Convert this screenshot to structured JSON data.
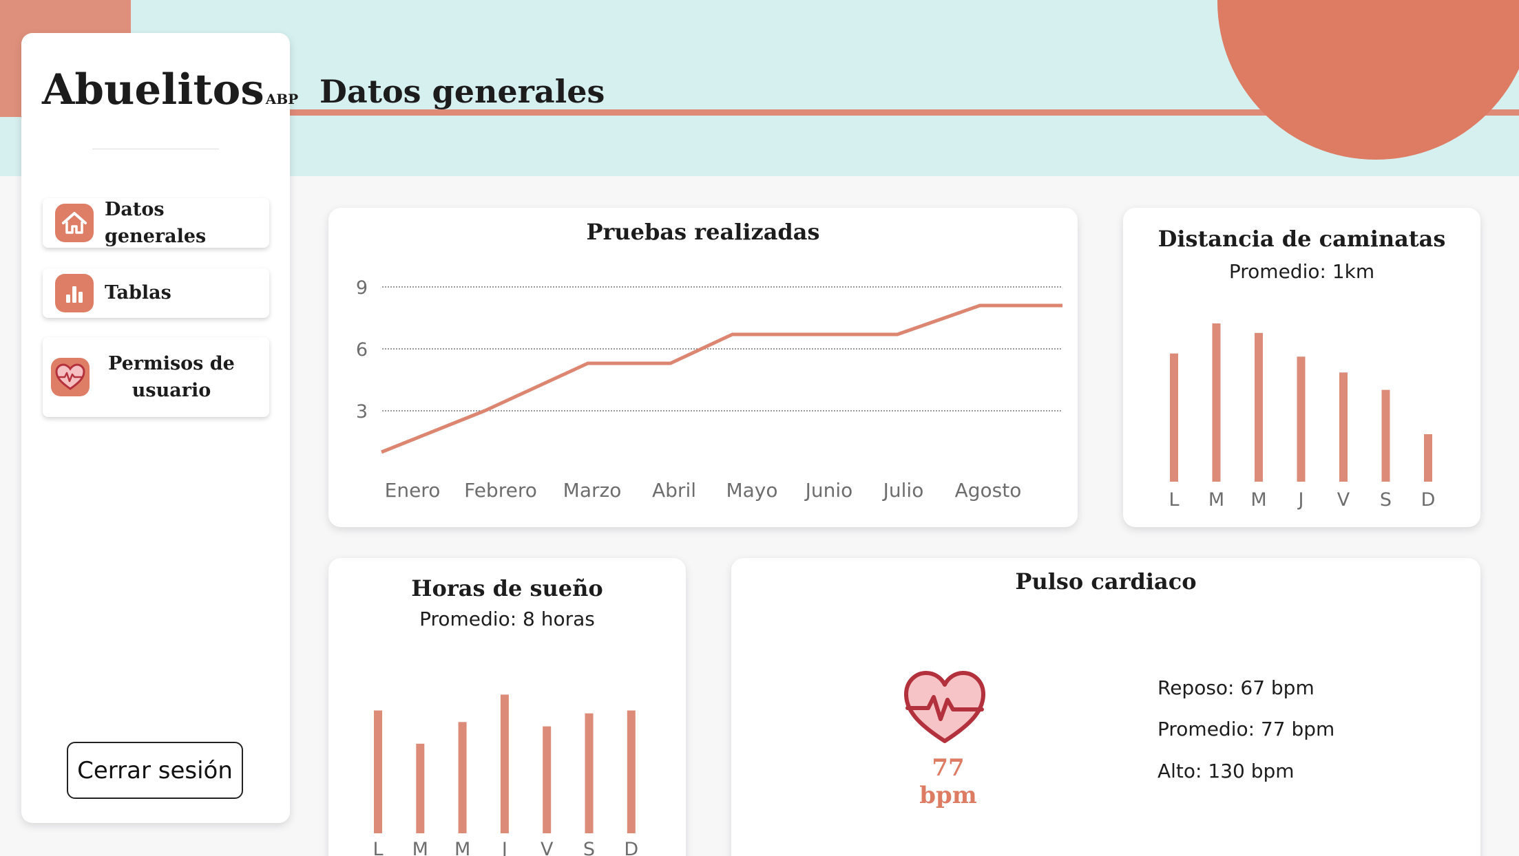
{
  "app": {
    "name": "Abuelitos",
    "suffix": "ABP"
  },
  "header": {
    "title": "Datos generales"
  },
  "sidebar": {
    "items": [
      {
        "label": "Datos generales",
        "icon": "home-icon"
      },
      {
        "label": "Tablas",
        "icon": "bar-chart-icon"
      },
      {
        "label": "Permisos de usuario",
        "icon": "heart-pulse-icon"
      }
    ],
    "logout_label": "Cerrar sesión"
  },
  "cards": {
    "pruebas": {
      "title": "Pruebas realizadas"
    },
    "distancia": {
      "title": "Distancia de caminatas",
      "subtitle": "Promedio: 1km"
    },
    "sueno": {
      "title": "Horas de sueño",
      "subtitle": "Promedio: 8 horas"
    },
    "pulso": {
      "title": "Pulso cardiaco",
      "current": "77 bpm",
      "stats": [
        "Reposo: 67 bpm",
        "Promedio: 77 bpm",
        "Alto: 130 bpm"
      ],
      "icon": "heart-pulse-icon"
    }
  },
  "colors": {
    "accent": "#dd7b63",
    "header_bg": "#d6efef",
    "bar": "#dc8b78",
    "line": "#dc8672"
  },
  "chart_data": [
    {
      "id": "pruebas",
      "type": "line",
      "title": "Pruebas realizadas",
      "categories": [
        "Enero",
        "Febrero",
        "Marzo",
        "Abril",
        "Mayo",
        "Junio",
        "Julio",
        "Agosto"
      ],
      "x": [
        0,
        1.25,
        2.5,
        3.5,
        4.25,
        5.25,
        6.25,
        7.25,
        8.25
      ],
      "values": [
        1,
        3,
        5.3,
        5.3,
        6.7,
        6.7,
        6.7,
        8.1,
        8.1
      ],
      "yticks": [
        3,
        6,
        9
      ],
      "ylim": [
        0,
        9.5
      ],
      "grid": true
    },
    {
      "id": "distancia",
      "type": "bar",
      "title": "Distancia de caminatas",
      "subtitle": "Promedio: 1km",
      "categories": [
        "L",
        "M",
        "M",
        "J",
        "V",
        "S",
        "D"
      ],
      "values": [
        0.81,
        1.0,
        0.94,
        0.79,
        0.69,
        0.58,
        0.3
      ],
      "ylim": [
        0,
        1
      ]
    },
    {
      "id": "sueno",
      "type": "bar",
      "title": "Horas de sueño",
      "subtitle": "Promedio: 8 horas",
      "categories": [
        "L",
        "M",
        "M",
        "J",
        "V",
        "S",
        "D"
      ],
      "values": [
        8.5,
        6.2,
        7.7,
        9.6,
        7.4,
        8.3,
        8.5
      ],
      "ylim": [
        0,
        10
      ]
    }
  ]
}
